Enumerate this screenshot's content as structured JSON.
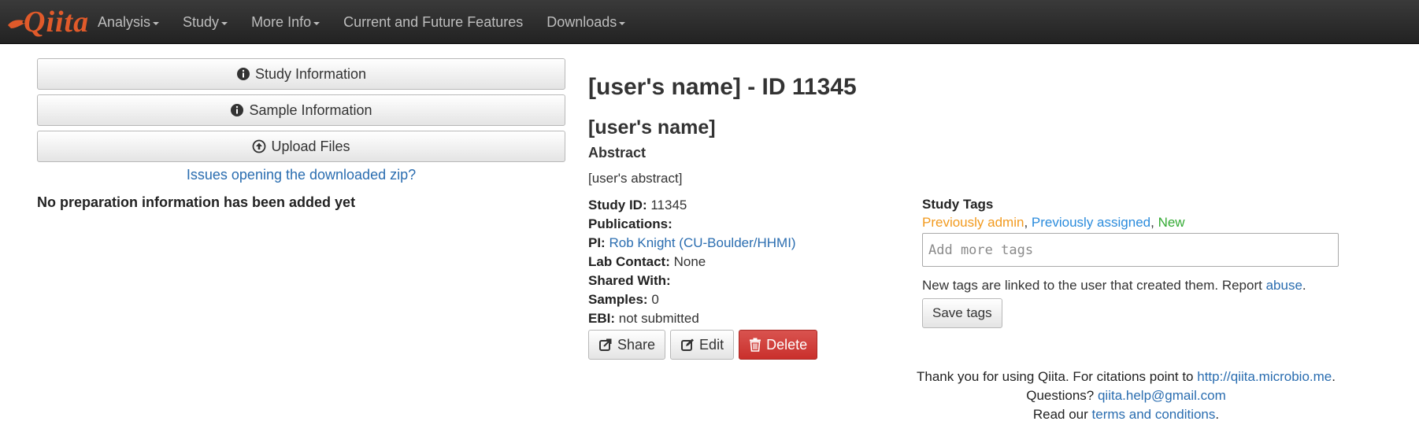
{
  "navbar": {
    "brand": "Qiita",
    "items": [
      {
        "label": "Analysis",
        "dropdown": true
      },
      {
        "label": "Study",
        "dropdown": true
      },
      {
        "label": "More Info",
        "dropdown": true
      },
      {
        "label": "Current and Future Features",
        "dropdown": false
      },
      {
        "label": "Downloads",
        "dropdown": true
      }
    ]
  },
  "sidebar": {
    "study_info": "Study Information",
    "sample_info": "Sample Information",
    "upload_files": "Upload Files",
    "zip_link": "Issues opening the downloaded zip?",
    "no_prep": "No preparation information has been added yet"
  },
  "study": {
    "title": "[user's name] - ID 11345",
    "subtitle": "[user's name]",
    "abstract_heading": "Abstract",
    "abstract": "[user's abstract]",
    "fields": {
      "study_id_label": "Study ID:",
      "study_id": "11345",
      "publications_label": "Publications:",
      "pi_label": "PI:",
      "pi": "Rob Knight (CU-Boulder/HHMI)",
      "lab_contact_label": "Lab Contact:",
      "lab_contact": "None",
      "shared_with_label": "Shared With:",
      "samples_label": "Samples:",
      "samples": "0",
      "ebi_label": "EBI:",
      "ebi": "not submitted"
    },
    "actions": {
      "share": "Share",
      "edit": "Edit",
      "delete": "Delete"
    }
  },
  "tags": {
    "heading": "Study Tags",
    "admin": "Previously admin",
    "assigned": "Previously assigned",
    "new": "New",
    "sep": ", ",
    "placeholder": "Add more tags",
    "note": "New tags are linked to the user that created them. Report ",
    "abuse_link": "abuse",
    "note_end": ".",
    "save": "Save tags"
  },
  "footer": {
    "line1": "Thank you for using Qiita. For citations point to ",
    "line1_link": "http://qiita.microbio.me",
    "line1_end": ".",
    "line2": "Questions? ",
    "line2_link": "qiita.help@gmail.com",
    "line3": "Read our ",
    "line3_link": "terms and conditions",
    "line3_end": "."
  },
  "colors": {
    "navbar": "#222222",
    "brand": "#e05a2a",
    "link": "#2a6db0",
    "danger": "#d9534f",
    "tag_admin": "#f29a1e",
    "tag_assigned": "#2a8bdc",
    "tag_new": "#33aa33"
  },
  "icons": {
    "study_info": "info-circle-icon",
    "sample_info": "info-circle-icon",
    "upload": "upload-circle-icon",
    "share": "share-icon",
    "edit": "edit-icon",
    "delete": "trash-icon",
    "brand": "qiita-bird-icon"
  }
}
